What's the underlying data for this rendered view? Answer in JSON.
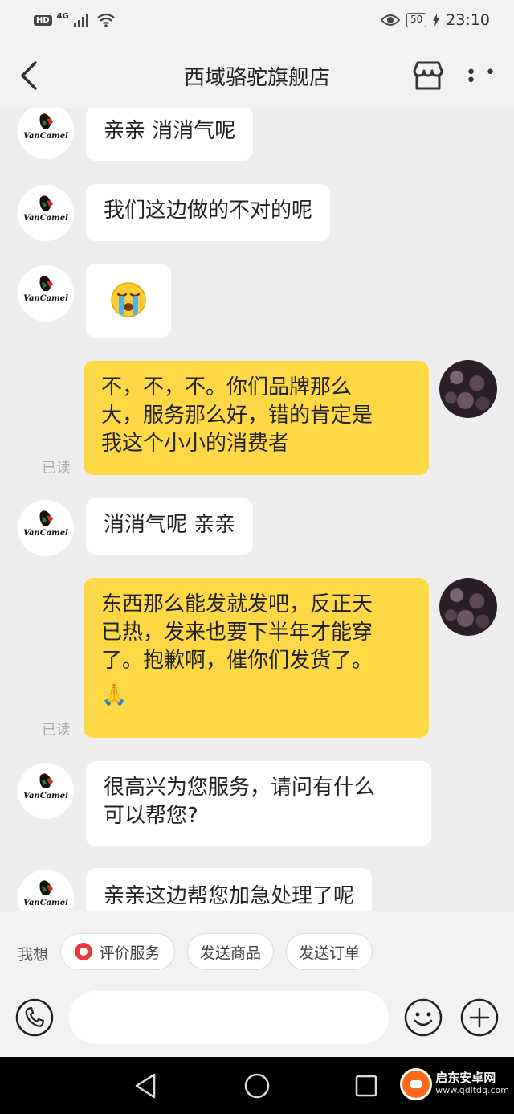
{
  "status_bar": {
    "hd": "HD",
    "network": "4G",
    "battery": "50",
    "time": "23:10"
  },
  "header": {
    "title": "西域骆驼旗舰店"
  },
  "messages": [
    {
      "side": "left",
      "text": "亲亲 消消气呢"
    },
    {
      "side": "left",
      "text": "我们这边做的不对的呢"
    },
    {
      "side": "left",
      "type": "emoji",
      "emoji": "crying-face"
    },
    {
      "side": "right",
      "lines": [
        "不，不，不。你们品牌那么",
        "大，服务那么好，错的肯定是",
        "我这个小小的消费者"
      ],
      "read": "已读"
    },
    {
      "side": "left",
      "text": "消消气呢 亲亲"
    },
    {
      "side": "right",
      "lines": [
        "东西那么能发就发吧，反正天",
        "已热，发来也要下半年才能穿",
        "了。抱歉啊，催你们发货了。"
      ],
      "emoji_suffix": "🙏",
      "read": "已读"
    },
    {
      "side": "left",
      "lines": [
        "很高兴为您服务，请问有什么",
        "可以帮您?"
      ]
    },
    {
      "side": "left",
      "text": "亲亲这边帮您加急处理了呢"
    }
  ],
  "store_avatar_text": "VanCamel",
  "quick_replies": {
    "label": "我想",
    "items": [
      "评价服务",
      "发送商品",
      "发送订单"
    ]
  },
  "input": {
    "placeholder": ""
  },
  "watermark": {
    "title": "启东安卓网",
    "url": "www.qdltdq.com"
  },
  "colors": {
    "my_bubble": "#fed945",
    "their_bubble": "#ffffff",
    "background": "#eeeeee"
  }
}
